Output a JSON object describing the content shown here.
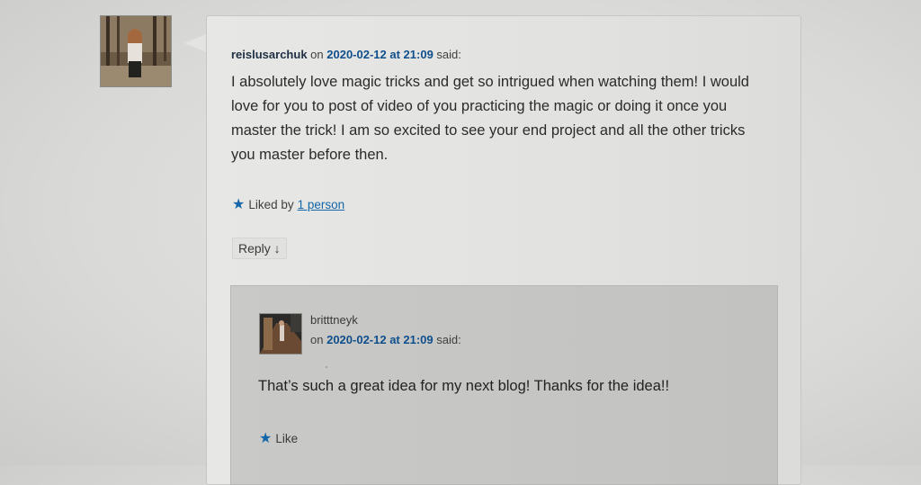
{
  "comment": {
    "author": "reislusarchuk",
    "on": "on",
    "date": "2020-02-12 at 21:09",
    "said": "said:",
    "body_lines": [
      "I absolutely love magic tricks and get so intrigued when watching them! I would",
      "love for you to post of video of you practicing the magic or doing it once you",
      "master the trick! I am so excited to see your end project and all the other tricks",
      "you master before then."
    ],
    "liked_prefix": "Liked by",
    "liked_link": "1 person",
    "reply_label": "Reply ↓",
    "star_icon": "star-icon"
  },
  "reply": {
    "author": "britttneyk",
    "on": "on",
    "date": "2020-02-12 at 21:09",
    "said": "said:",
    "body": "That’s such a great idea for my next blog! Thanks for the idea!!",
    "like_label": "Like",
    "star_icon": "star-icon"
  },
  "colors": {
    "link": "#1466a8",
    "date": "#0f4f8c"
  }
}
